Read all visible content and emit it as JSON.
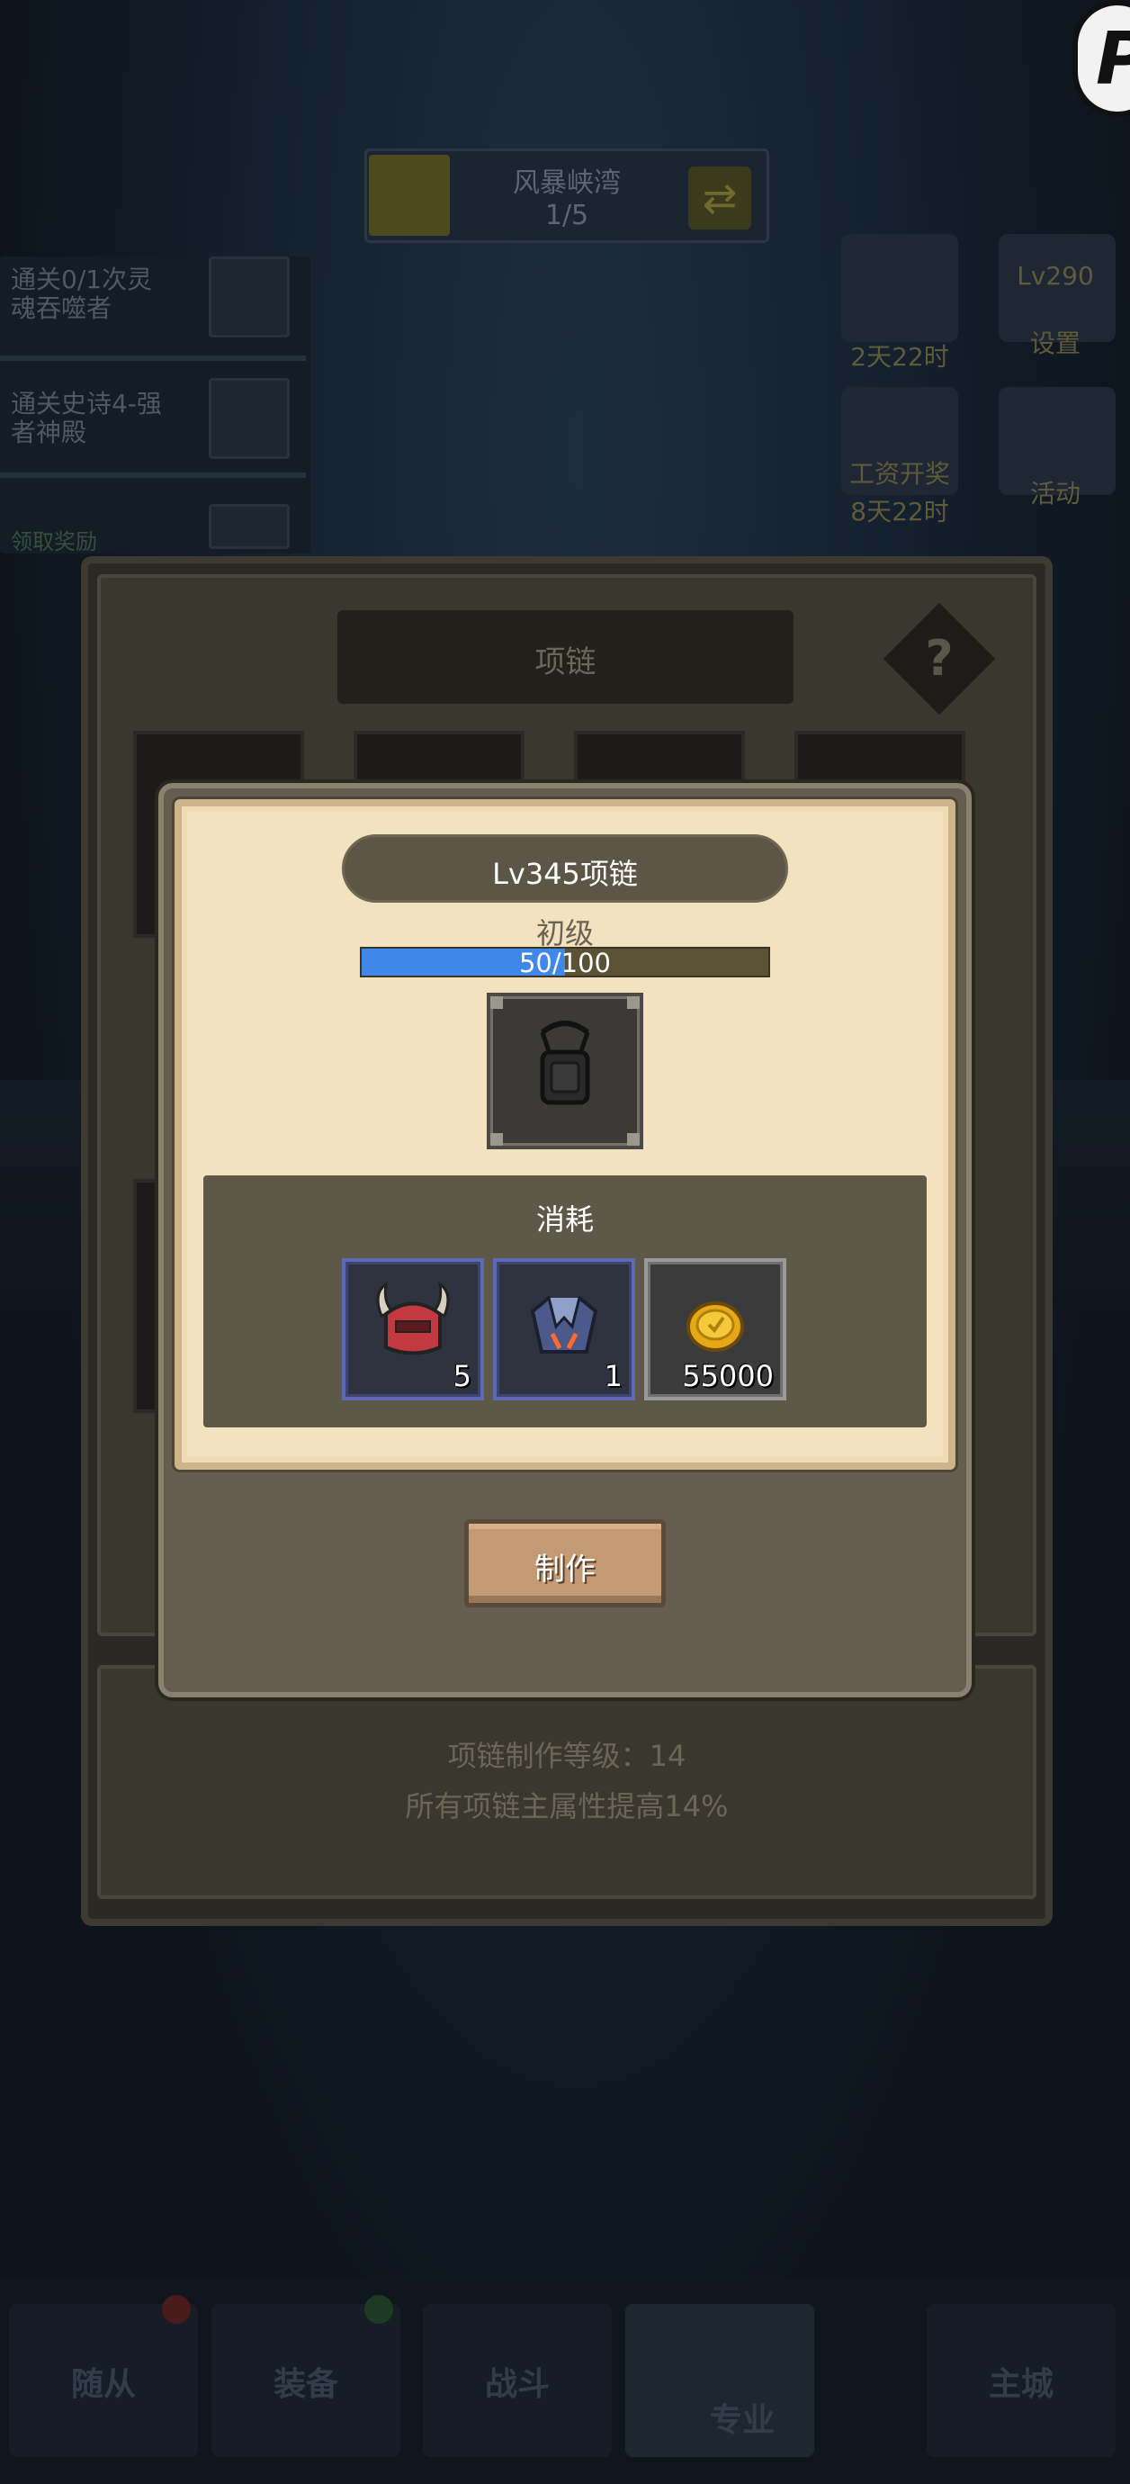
{
  "background": {
    "stage": {
      "title": "风暴峡湾",
      "count": "1/5",
      "swap_icon": "swap-icon"
    },
    "quests": [
      {
        "line1": "通关0/1次灵",
        "line2": "魂吞噬者"
      },
      {
        "line1": "通关史诗4-强",
        "line2": "者神殿"
      },
      {
        "line1": "领取奖励",
        "line2": ""
      }
    ],
    "side_items": [
      {
        "label": "...",
        "sub": "2天22时"
      },
      {
        "label": "Lv290",
        "sub": "设置"
      },
      {
        "label": "工资开奖",
        "sub": "8天22时"
      },
      {
        "label": "",
        "sub": "活动"
      }
    ],
    "crafting_panel": {
      "title": "项链",
      "help_symbol": "?",
      "info_line1": "项链制作等级：14",
      "info_line2": "所有项链主属性提高14%"
    },
    "bottom_nav": [
      "随从",
      "装备",
      "战斗",
      "专业",
      "主城"
    ],
    "corner_badge": "P"
  },
  "modal": {
    "title": "Lv345项链",
    "grade": "初级",
    "progress": {
      "current": 50,
      "max": 100,
      "text": "50/100"
    },
    "item_icon": "necklace-icon",
    "consume_title": "消耗",
    "materials": [
      {
        "icon": "horned-helmet-icon",
        "count": "5"
      },
      {
        "icon": "crystal-gauntlet-icon",
        "count": "1"
      },
      {
        "icon": "gold-coin-icon",
        "count": "55000"
      }
    ],
    "craft_button": "制作"
  },
  "colors": {
    "parchment": "#f3e2bf",
    "progress_fill": "#3f87e8",
    "button_wood": "#c49a74",
    "material_border": "#5e6ab5"
  }
}
